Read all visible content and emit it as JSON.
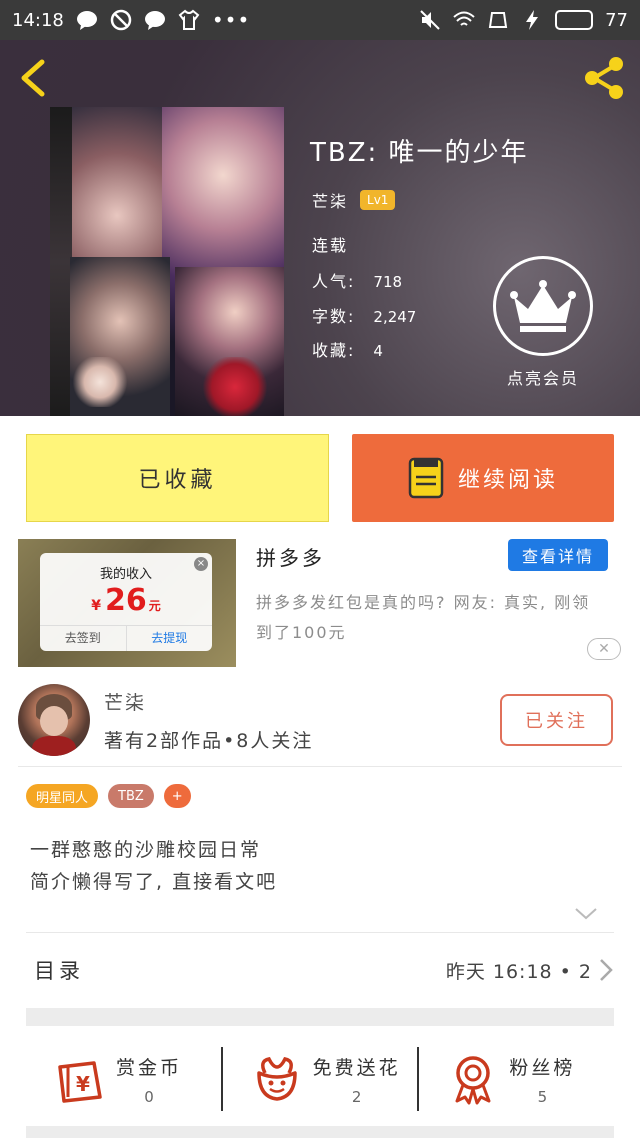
{
  "status_bar": {
    "time": "14:18",
    "battery": "77",
    "battery_fraction": 0.77
  },
  "book": {
    "title": "TBZ:  唯一的少年",
    "author": "芒柒",
    "author_level": "Lv1",
    "status": "连载",
    "popularity_label": "人气:",
    "popularity": "718",
    "word_count_label": "字数:",
    "word_count": "2,247",
    "favorites_label": "收藏:",
    "favorites": "4",
    "vip_label": "点亮会员"
  },
  "actions": {
    "favorited_label": "已收藏",
    "continue_label": "继续阅读"
  },
  "ad": {
    "card_title": "我的收入",
    "currency": "¥",
    "amount": "26",
    "unit": "元",
    "checkin": "去签到",
    "withdraw": "去提现",
    "title": "拼多多",
    "detail_button": "查看详情",
    "description": "拼多多发红包是真的吗? 网友: 真实, 刚领到了100元"
  },
  "author_info": {
    "name": "芒柒",
    "stats": "著有2部作品•8人关注",
    "follow_label": "已关注"
  },
  "tags": [
    {
      "label": "明星同人",
      "color": "#f5a623"
    },
    {
      "label": "TBZ",
      "color": "#c97a6a"
    },
    {
      "label": "+",
      "color": "#ee6b3c"
    }
  ],
  "intro": {
    "line1": "一群憨憨的沙雕校园日常",
    "line2": "简介懒得写了, 直接看文吧"
  },
  "catalog": {
    "title": "目录",
    "update": "昨天 16:18 • 2"
  },
  "stats": [
    {
      "label": "赏金币",
      "value": "0",
      "icon": "red-envelope-icon"
    },
    {
      "label": "免费送花",
      "value": "2",
      "icon": "flower-icon"
    },
    {
      "label": "粉丝榜",
      "value": "5",
      "icon": "award-ribbon-icon"
    }
  ],
  "colors": {
    "accent": "#ee6b3c",
    "favorite_yellow": "#fff57a",
    "link_blue": "#1f7ae4",
    "level_gold": "#f1b52b"
  }
}
